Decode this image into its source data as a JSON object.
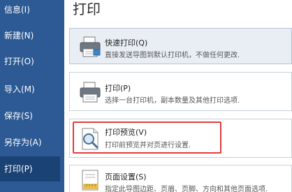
{
  "sidebar": {
    "items": [
      {
        "label": "信息(I)",
        "active": false
      },
      {
        "label": "新建(N)",
        "active": false
      },
      {
        "label": "打开(O)",
        "active": false
      },
      {
        "label": "导入(M)",
        "active": false
      },
      {
        "label": "保存(S)",
        "active": false
      },
      {
        "label": "另存为(A)",
        "active": false
      },
      {
        "label": "打印(P)",
        "active": true
      }
    ]
  },
  "main": {
    "title": "打印",
    "options": [
      {
        "title": "快速打印(Q)",
        "desc": "直接发送导图到默认打印机，不做任何更改.",
        "icon": "printer-icon"
      },
      {
        "title": "打印(P)",
        "desc": "选择一台打印机，副本数量及其他打印选项.",
        "icon": "printer-icon"
      },
      {
        "title": "打印预览(V)",
        "desc": "打印前预览并对页进行设置.",
        "icon": "print-preview-icon"
      },
      {
        "title": "页面设置(S)",
        "desc": "指定此导图边距、页眉、页脚、方向和其他页面选项.",
        "icon": "page-setup-icon"
      }
    ]
  },
  "colors": {
    "sidebar_bg": "#2d5a94",
    "sidebar_active": "#1b4274",
    "highlight": "#e23b3b"
  }
}
